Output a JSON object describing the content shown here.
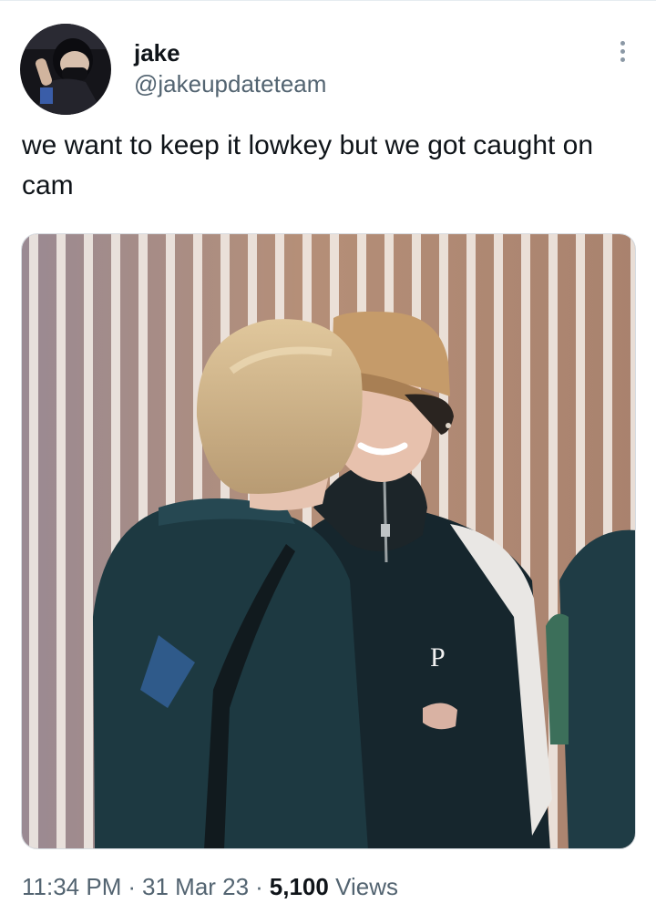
{
  "tweet": {
    "author": {
      "display_name": "jake",
      "handle": "@jakeupdateteam"
    },
    "text": "we want to keep it lowkey but we got caught on cam",
    "timestamp": {
      "time": "11:34 PM",
      "separator": "·",
      "date": "31 Mar 23"
    },
    "views": {
      "count": "5,100",
      "label": "Views"
    },
    "media": {
      "jacket_print": "P"
    }
  },
  "colors": {
    "text_primary": "#0f1419",
    "text_secondary": "#536471",
    "icon_gray": "#8b98a5",
    "border": "#d6dbe0"
  },
  "icons": {
    "more": "more-vertical-icon"
  }
}
